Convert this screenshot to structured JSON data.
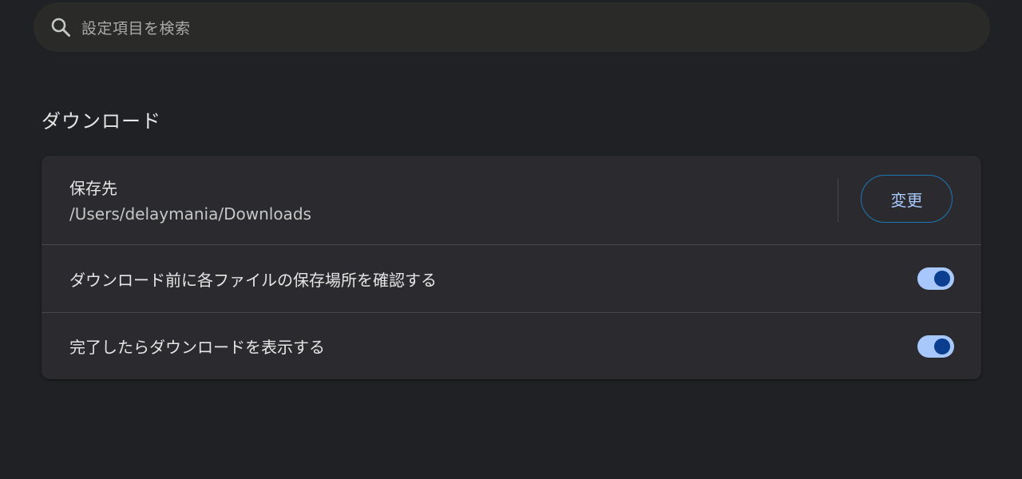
{
  "search": {
    "placeholder": "設定項目を検索",
    "icon": "search-icon"
  },
  "section": {
    "title": "ダウンロード"
  },
  "location": {
    "label": "保存先",
    "path": "/Users/delaymania/Downloads",
    "change_button_label": "変更"
  },
  "settings": [
    {
      "label": "ダウンロード前に各ファイルの保存場所を確認する",
      "enabled": true
    },
    {
      "label": "完了したらダウンロードを表示する",
      "enabled": true
    }
  ],
  "colors": {
    "background": "#202124",
    "card": "#2b2b2f",
    "accent": "#a8c7fa",
    "toggle_knob": "#0b3e8f",
    "button_border": "#1b78b4"
  }
}
